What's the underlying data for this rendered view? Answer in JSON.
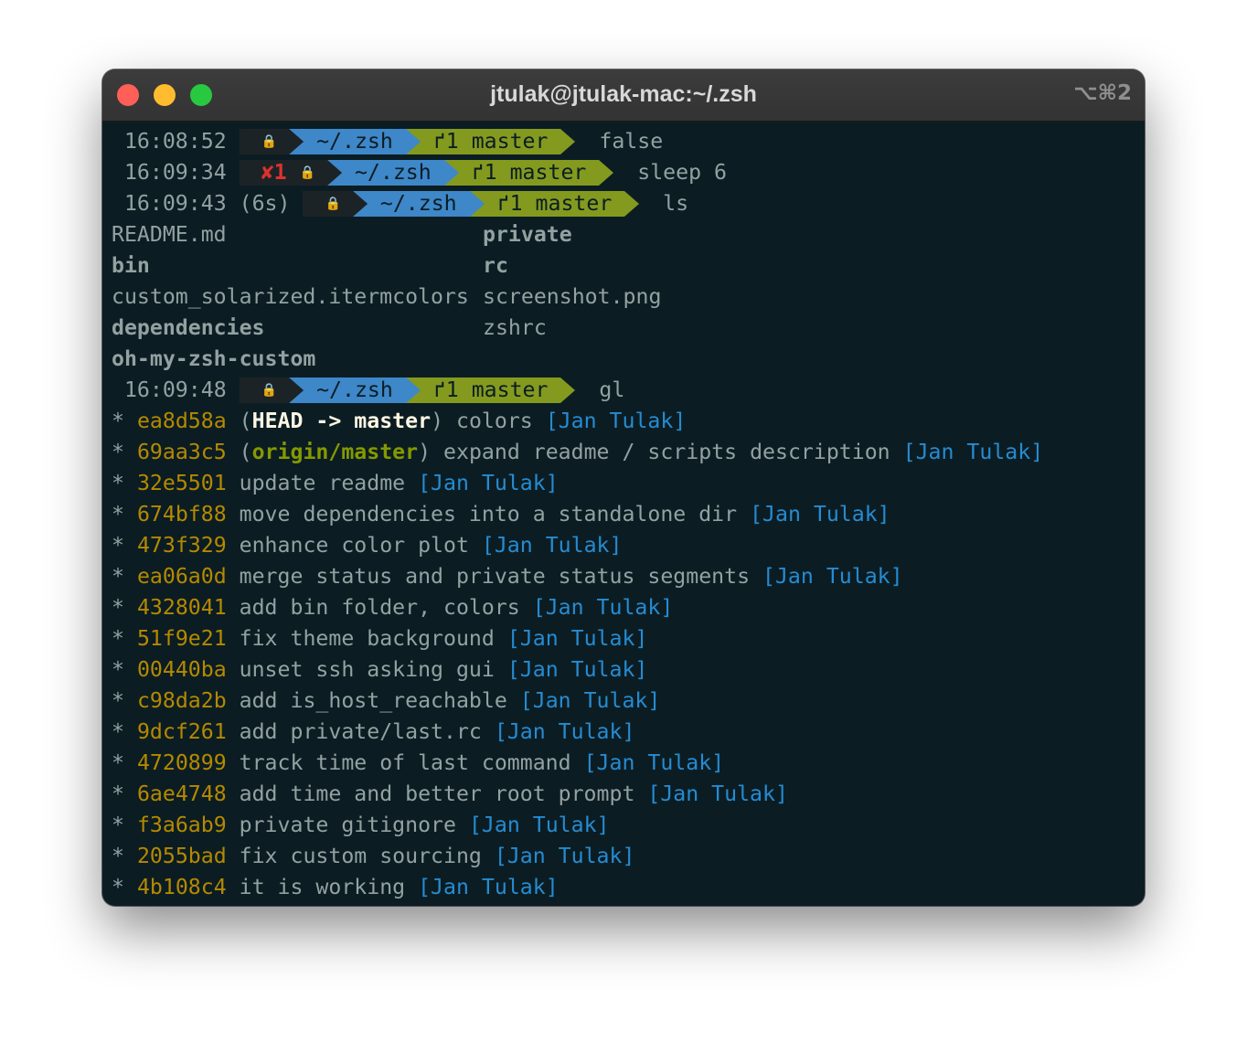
{
  "window": {
    "title": "jtulak@jtulak-mac:~/.zsh",
    "shortcut": "⌥⌘2",
    "lights": {
      "close": "#fe5f57",
      "minimize": "#febc2e",
      "zoom": "#28c840"
    }
  },
  "colors": {
    "background": "#0b1d23",
    "path_segment": "#3e87c9",
    "git_segment": "#849a1f",
    "hash": "#b58900",
    "author": "#268bd2",
    "error": "#dc322f"
  },
  "prompts": [
    {
      "time": "16:08:52",
      "status_icon": "lock-icon",
      "path": "~/.zsh",
      "git": "ґ1 master",
      "command": "false"
    },
    {
      "time": "16:09:34",
      "error": "✘1",
      "status_icon": "lock-icon",
      "path": "~/.zsh",
      "git": "ґ1 master",
      "command": "sleep 6"
    },
    {
      "time": "16:09:43",
      "duration": "(6s)",
      "status_icon": "lock-icon",
      "path": "~/.zsh",
      "git": "ґ1 master",
      "command": "ls"
    },
    {
      "time": "16:09:48",
      "status_icon": "lock-icon",
      "path": "~/.zsh",
      "git": "ґ1 master",
      "command": "gl"
    }
  ],
  "ls_output": [
    [
      "README.md",
      "private"
    ],
    [
      "bin",
      "rc"
    ],
    [
      "custom_solarized.itermcolors",
      "screenshot.png"
    ],
    [
      "dependencies",
      "zshrc"
    ],
    [
      "oh-my-zsh-custom",
      ""
    ]
  ],
  "git_log": [
    {
      "star": "*",
      "hash": "ea8d58a",
      "ref_open": "(",
      "ref_head": "HEAD -> master",
      "ref_close": ")",
      "message": "colors",
      "author": "[Jan Tulak]"
    },
    {
      "star": "*",
      "hash": "69aa3c5",
      "ref_open": "(",
      "ref_origin": "origin/master",
      "ref_close": ")",
      "message": "expand readme / scripts description",
      "author": "[Jan Tulak]"
    },
    {
      "star": "*",
      "hash": "32e5501",
      "message": "update readme",
      "author": "[Jan Tulak]"
    },
    {
      "star": "*",
      "hash": "674bf88",
      "message": "move dependencies into a standalone dir",
      "author": "[Jan Tulak]"
    },
    {
      "star": "*",
      "hash": "473f329",
      "message": "enhance color plot",
      "author": "[Jan Tulak]"
    },
    {
      "star": "*",
      "hash": "ea06a0d",
      "message": "merge status and private status segments",
      "author": "[Jan Tulak]"
    },
    {
      "star": "*",
      "hash": "4328041",
      "message": "add bin folder, colors",
      "author": "[Jan Tulak]"
    },
    {
      "star": "*",
      "hash": "51f9e21",
      "message": "fix theme background",
      "author": "[Jan Tulak]"
    },
    {
      "star": "*",
      "hash": "00440ba",
      "message": "unset ssh asking gui",
      "author": "[Jan Tulak]"
    },
    {
      "star": "*",
      "hash": "c98da2b",
      "message": "add is_host_reachable",
      "author": "[Jan Tulak]"
    },
    {
      "star": "*",
      "hash": "9dcf261",
      "message": "add private/last.rc",
      "author": "[Jan Tulak]"
    },
    {
      "star": "*",
      "hash": "4720899",
      "message": "track time of last command",
      "author": "[Jan Tulak]"
    },
    {
      "star": "*",
      "hash": "6ae4748",
      "message": "add time and better root prompt",
      "author": "[Jan Tulak]"
    },
    {
      "star": "*",
      "hash": "f3a6ab9",
      "message": "private gitignore",
      "author": "[Jan Tulak]"
    },
    {
      "star": "*",
      "hash": "2055bad",
      "message": "fix custom sourcing",
      "author": "[Jan Tulak]"
    },
    {
      "star": "*",
      "hash": "4b108c4",
      "message": "it is working",
      "author": "[Jan Tulak]"
    }
  ]
}
